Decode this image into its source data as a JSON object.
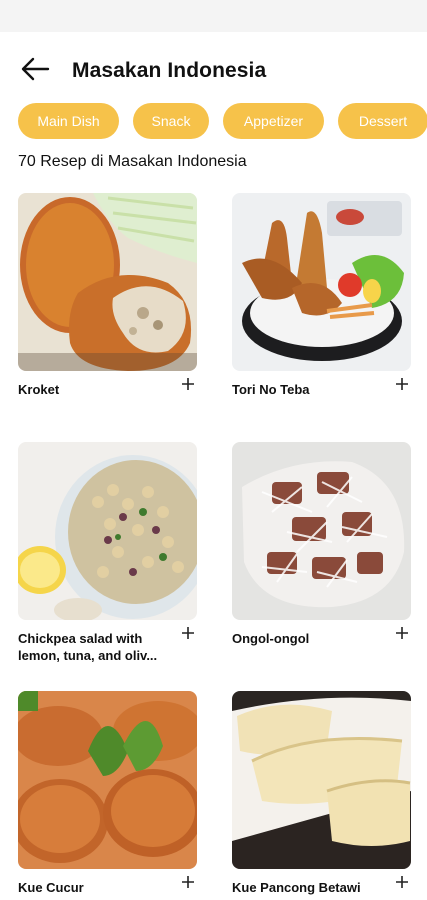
{
  "header": {
    "title": "Masakan Indonesia",
    "back_icon": "arrow-left-icon"
  },
  "categories": [
    "Main Dish",
    "Snack",
    "Appetizer",
    "Dessert"
  ],
  "colors": {
    "chip_background": "#f6c24a",
    "chip_text": "#ffffff",
    "text": "#111111",
    "background": "#ffffff"
  },
  "recipe_count_text": "70 Resep di Masakan Indonesia",
  "recipes": [
    {
      "name": "Kroket",
      "add_icon": "plus-icon"
    },
    {
      "name": "Tori No Teba",
      "add_icon": "plus-icon"
    },
    {
      "name": "Chickpea salad with lemon, tuna, and oliv...",
      "add_icon": "plus-icon"
    },
    {
      "name": "Ongol-ongol",
      "add_icon": "plus-icon"
    },
    {
      "name": "Kue Cucur",
      "add_icon": "plus-icon"
    },
    {
      "name": "Kue Pancong Betawi",
      "add_icon": "plus-icon"
    }
  ]
}
